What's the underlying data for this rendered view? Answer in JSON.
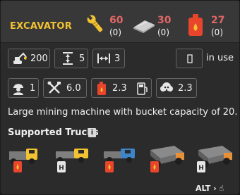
{
  "title": "EXCAVATOR",
  "costs": [
    {
      "icon": "wrench-icon",
      "value": "60",
      "available": "(0)"
    },
    {
      "icon": "steel-plate-icon",
      "value": "30",
      "available": "(0)"
    },
    {
      "icon": "fuel-can-icon",
      "value": "27",
      "available": "(0)"
    }
  ],
  "stats": {
    "capacity": "200",
    "height": "5",
    "width": "3",
    "in_use_label": "in use",
    "workers": "1",
    "maintenance": "6.0",
    "fuel": "2.3",
    "pollution": "2.3"
  },
  "description": "Large mining machine with bucket capacity of 20.",
  "supported_trucks": {
    "heading": "Supported Trucks",
    "info_glyph": "i",
    "trucks": [
      {
        "name": "truck-yellow-small-icon",
        "fuel": "diesel"
      },
      {
        "name": "truck-yellow-hydrogen-icon",
        "fuel": "hydrogen"
      },
      {
        "name": "truck-blue-icon",
        "fuel": "diesel"
      },
      {
        "name": "truck-large-gray-icon",
        "fuel": "diesel"
      },
      {
        "name": "truck-large-hydrogen-icon",
        "fuel": "hydrogen"
      }
    ]
  },
  "footer": {
    "alt_label": "ALT"
  },
  "colors": {
    "accent": "#f1c232",
    "cost": "#e06666",
    "fuel": "#e8452c"
  }
}
